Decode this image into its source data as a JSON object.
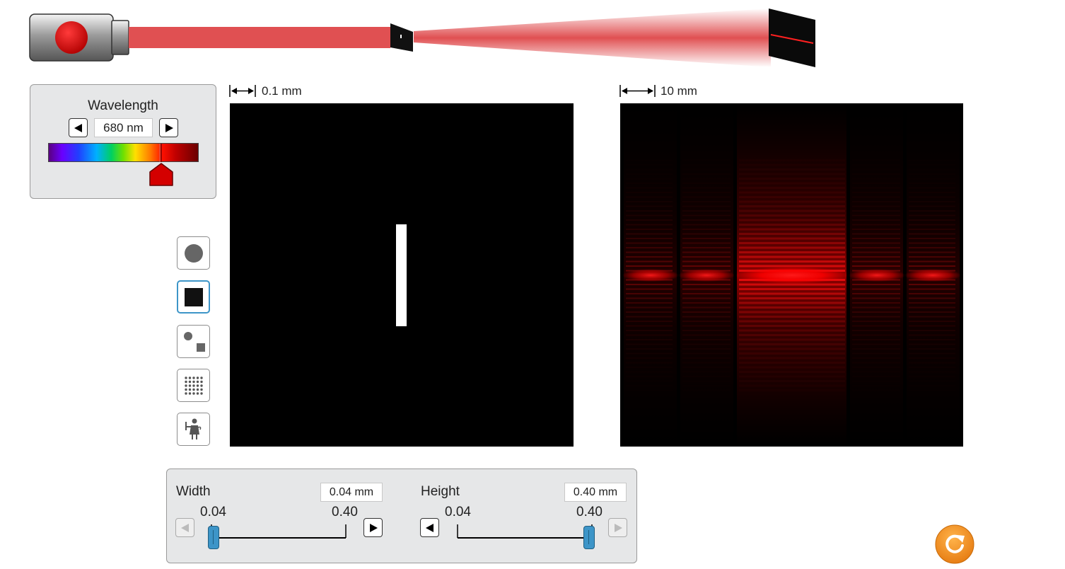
{
  "wavelength": {
    "title": "Wavelength",
    "value": "680 nm",
    "decrease_icon": "left-triangle-icon",
    "increase_icon": "right-triangle-icon",
    "slider_fraction": 0.7
  },
  "slit_view": {
    "scale_text": "0.1 mm"
  },
  "screen_view": {
    "scale_text": "10 mm"
  },
  "shapes": [
    {
      "name": "circle",
      "icon": "circle-icon"
    },
    {
      "name": "rectangle",
      "icon": "square-icon",
      "selected": true
    },
    {
      "name": "circle-and-square",
      "icon": "circle-square-icon"
    },
    {
      "name": "dot-grid",
      "icon": "dot-grid-icon"
    },
    {
      "name": "person",
      "icon": "person-icon"
    }
  ],
  "width_control": {
    "label": "Width",
    "value": "0.04 mm",
    "min_label": "0.04",
    "max_label": "0.40"
  },
  "height_control": {
    "label": "Height",
    "value": "0.40 mm",
    "min_label": "0.04",
    "max_label": "0.40"
  },
  "colors": {
    "laser": "#e05052",
    "accent": "#3d95c8",
    "reset": "#f08a1c"
  }
}
